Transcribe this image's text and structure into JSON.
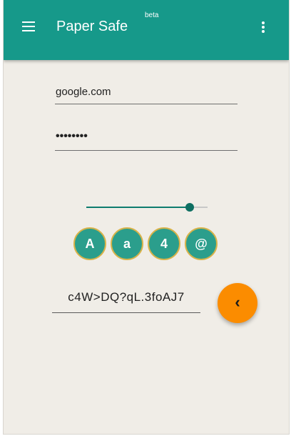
{
  "appbar": {
    "title": "Paper Safe",
    "badge": "beta",
    "color": "#16998a",
    "menu_icon": "hamburger-menu-icon",
    "overflow_icon": "more-vert-icon"
  },
  "form": {
    "site_value": "google.com",
    "password_masked": "••••••••"
  },
  "options": {
    "length_level": 0.85,
    "toggles": [
      {
        "label": "A"
      },
      {
        "label": "a"
      },
      {
        "label": "4"
      },
      {
        "label": "@"
      }
    ]
  },
  "result": {
    "password": "c4W>DQ?qL.3foAJ7"
  },
  "fab": {
    "icon": "chevron-left-icon",
    "glyph": "‹",
    "color": "#fb8c00"
  }
}
